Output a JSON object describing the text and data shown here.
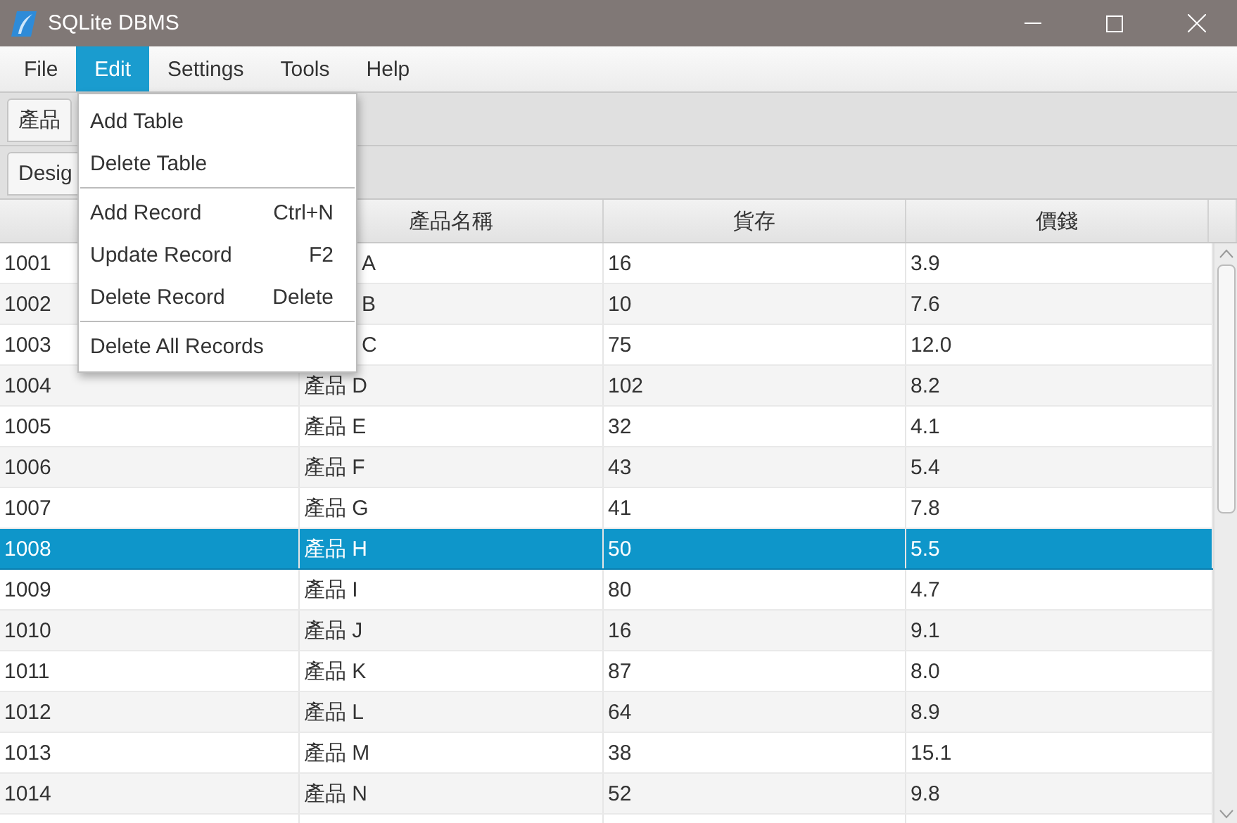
{
  "window": {
    "title": "SQLite DBMS"
  },
  "menu_bar": [
    {
      "label": "File",
      "selected": false
    },
    {
      "label": "Edit",
      "selected": true
    },
    {
      "label": "Settings",
      "selected": false
    },
    {
      "label": "Tools",
      "selected": false
    },
    {
      "label": "Help",
      "selected": false
    }
  ],
  "open_menu": {
    "items": [
      {
        "kind": "item",
        "label": "Add Table"
      },
      {
        "kind": "item",
        "label": "Delete Table"
      },
      {
        "kind": "separator"
      },
      {
        "kind": "item",
        "label": "Add Record",
        "shortcut": "Ctrl+N"
      },
      {
        "kind": "item",
        "label": "Update Record",
        "shortcut": "F2"
      },
      {
        "kind": "item",
        "label": "Delete Record",
        "shortcut": "Delete"
      },
      {
        "kind": "separator"
      },
      {
        "kind": "item",
        "label": "Delete All Records"
      }
    ]
  },
  "tabs": [
    {
      "label": "產品",
      "selected": true
    }
  ],
  "sub_tabs": [
    {
      "label": "Desig",
      "selected": true
    }
  ],
  "table": {
    "columns": [
      "產品名稱",
      "貨存",
      "價錢"
    ],
    "rows": [
      {
        "cells": [
          "1001",
          {
            "text": "A",
            "covered": true
          },
          "16",
          "3.9"
        ],
        "selected": false
      },
      {
        "cells": [
          "1002",
          {
            "text": "B",
            "covered": true
          },
          "10",
          "7.6"
        ],
        "selected": false
      },
      {
        "cells": [
          "1003",
          {
            "text": "C",
            "covered": true
          },
          "75",
          "12.0"
        ],
        "selected": false
      },
      {
        "cells": [
          "1004",
          "產品 D",
          "102",
          "8.2"
        ],
        "selected": false
      },
      {
        "cells": [
          "1005",
          "產品 E",
          "32",
          "4.1"
        ],
        "selected": false
      },
      {
        "cells": [
          "1006",
          "產品 F",
          "43",
          "5.4"
        ],
        "selected": false
      },
      {
        "cells": [
          "1007",
          "產品 G",
          "41",
          "7.8"
        ],
        "selected": false
      },
      {
        "cells": [
          "1008",
          "產品 H",
          "50",
          "5.5"
        ],
        "selected": true
      },
      {
        "cells": [
          "1009",
          "產品 I",
          "80",
          "4.7"
        ],
        "selected": false
      },
      {
        "cells": [
          "1010",
          "產品 J",
          "16",
          "9.1"
        ],
        "selected": false
      },
      {
        "cells": [
          "1011",
          "產品 K",
          "87",
          "8.0"
        ],
        "selected": false
      },
      {
        "cells": [
          "1012",
          "產品 L",
          "64",
          "8.9"
        ],
        "selected": false
      },
      {
        "cells": [
          "1013",
          "產品 M",
          "38",
          "15.1"
        ],
        "selected": false
      },
      {
        "cells": [
          "1014",
          "產品 N",
          "52",
          "9.8"
        ],
        "selected": false
      }
    ]
  }
}
